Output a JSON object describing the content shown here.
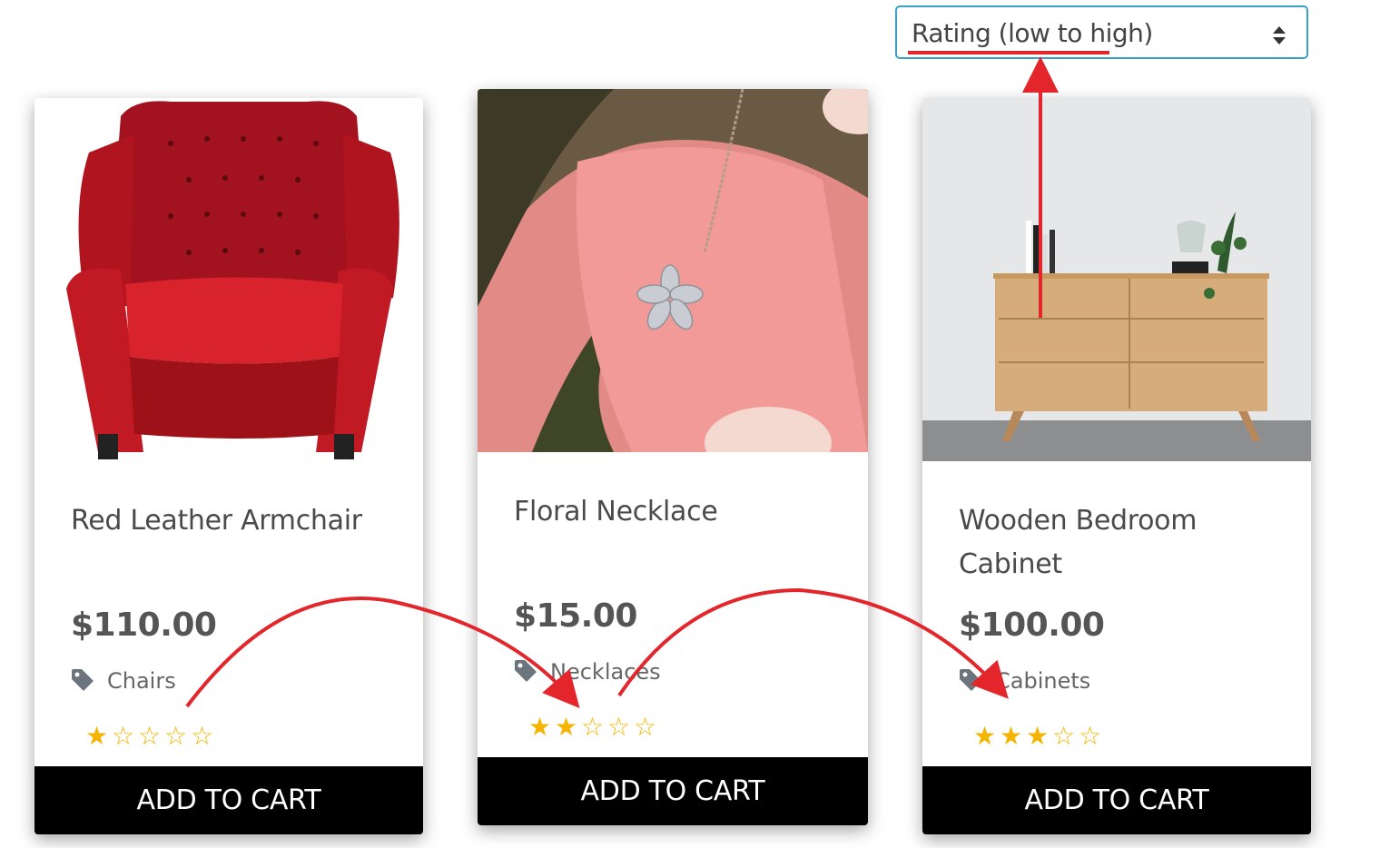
{
  "sort": {
    "selected": "Rating (low to high)"
  },
  "products": [
    {
      "name": "Red Leather Armchair",
      "price": "$110.00",
      "category": "Chairs",
      "rating": 1,
      "max_rating": 5,
      "cart_label": "ADD TO CART"
    },
    {
      "name": "Floral Necklace",
      "price": "$15.00",
      "category": "Necklaces",
      "rating": 2,
      "max_rating": 5,
      "cart_label": "ADD TO CART"
    },
    {
      "name": "Wooden Bedroom Cabinet",
      "price": "$100.00",
      "category": "Cabinets",
      "rating": 3,
      "max_rating": 5,
      "cart_label": "ADD TO CART"
    }
  ],
  "colors": {
    "annotation": "#e3262b",
    "star": "#f5b400",
    "select_border": "#3aa0c8",
    "button_bg": "#000000"
  }
}
